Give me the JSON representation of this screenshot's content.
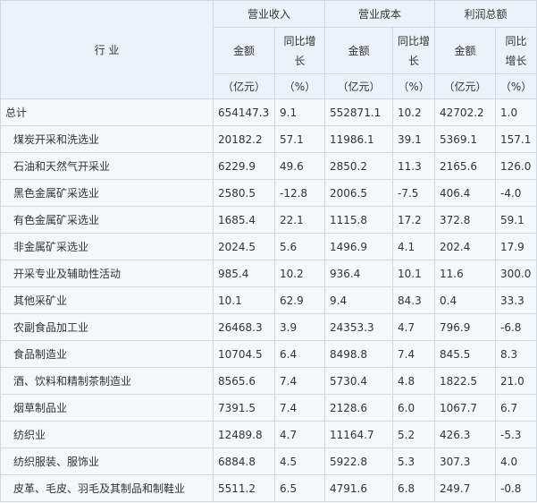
{
  "header": {
    "industry": "行 业",
    "groups": [
      "营业收入",
      "营业成本",
      "利润总额"
    ],
    "amount": "金额",
    "growth_line1": "同比增",
    "growth_line2": "长",
    "profit_growth_line1": "同比",
    "profit_growth_line2": "增长",
    "unit_amount": "（亿元）",
    "unit_pct": "（%）"
  },
  "rows": [
    {
      "name": "总计",
      "indent": false,
      "values": [
        "654147.3",
        "9.1",
        "552871.1",
        "10.2",
        "42702.2",
        "1.0"
      ]
    },
    {
      "name": "煤炭开采和洗选业",
      "indent": true,
      "values": [
        "20182.2",
        "57.1",
        "11986.1",
        "39.1",
        "5369.1",
        "157.1"
      ]
    },
    {
      "name": "石油和天然气开采业",
      "indent": true,
      "values": [
        "6229.9",
        "49.6",
        "2850.2",
        "11.3",
        "2165.6",
        "126.0"
      ]
    },
    {
      "name": "黑色金属矿采选业",
      "indent": true,
      "values": [
        "2580.5",
        "-12.8",
        "2006.5",
        "-7.5",
        "406.4",
        "-4.0"
      ]
    },
    {
      "name": "有色金属矿采选业",
      "indent": true,
      "values": [
        "1685.4",
        "22.1",
        "1115.8",
        "17.2",
        "372.8",
        "59.1"
      ]
    },
    {
      "name": "非金属矿采选业",
      "indent": true,
      "values": [
        "2024.5",
        "5.6",
        "1496.9",
        "4.1",
        "202.4",
        "17.9"
      ]
    },
    {
      "name": "开采专业及辅助性活动",
      "indent": true,
      "values": [
        "985.4",
        "10.2",
        "936.4",
        "10.1",
        "11.6",
        "300.0"
      ]
    },
    {
      "name": "其他采矿业",
      "indent": true,
      "values": [
        "10.1",
        "62.9",
        "9.4",
        "84.3",
        "0.4",
        "33.3"
      ]
    },
    {
      "name": "农副食品加工业",
      "indent": true,
      "values": [
        "26468.3",
        "3.9",
        "24353.3",
        "4.7",
        "796.9",
        "-6.8"
      ]
    },
    {
      "name": "食品制造业",
      "indent": true,
      "values": [
        "10704.5",
        "6.4",
        "8498.8",
        "7.4",
        "845.5",
        "8.3"
      ]
    },
    {
      "name": "酒、饮料和精制茶制造业",
      "indent": true,
      "values": [
        "8565.6",
        "7.4",
        "5730.4",
        "4.8",
        "1822.5",
        "21.0"
      ]
    },
    {
      "name": "烟草制品业",
      "indent": true,
      "values": [
        "7391.5",
        "7.4",
        "2128.6",
        "6.0",
        "1067.7",
        "6.7"
      ]
    },
    {
      "name": "纺织业",
      "indent": true,
      "values": [
        "12489.8",
        "4.7",
        "11164.7",
        "5.2",
        "426.3",
        "-5.3"
      ]
    },
    {
      "name": "纺织服装、服饰业",
      "indent": true,
      "values": [
        "6884.8",
        "4.5",
        "5922.8",
        "5.3",
        "307.3",
        "4.0"
      ]
    },
    {
      "name": "皮革、毛皮、羽毛及其制品和制鞋业",
      "indent": true,
      "values": [
        "5511.2",
        "6.5",
        "4791.6",
        "6.8",
        "249.7",
        "-0.8"
      ]
    }
  ]
}
